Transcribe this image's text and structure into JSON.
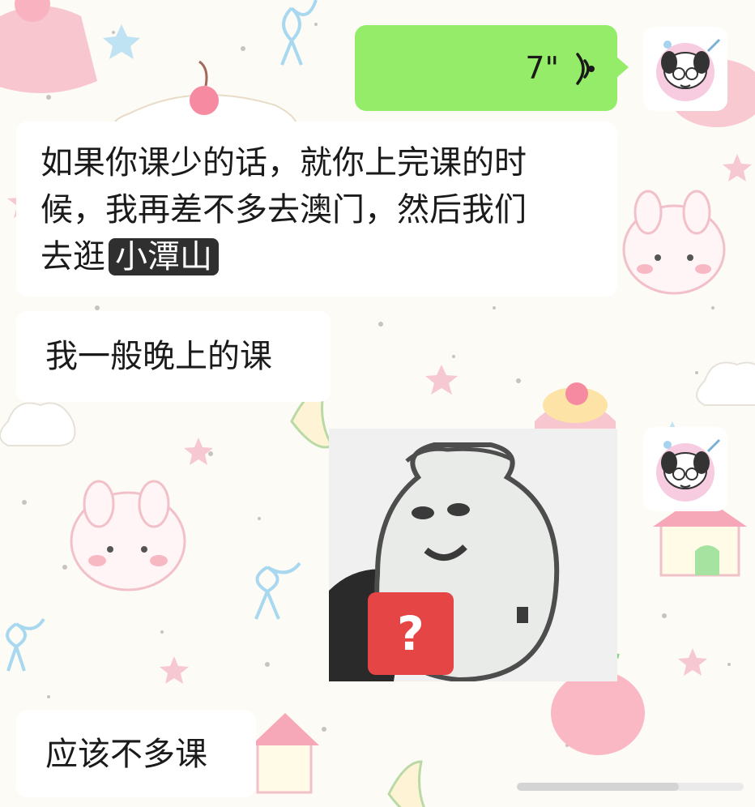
{
  "chat": {
    "voice_message": {
      "duration": "7\""
    },
    "messages": [
      {
        "text_line1": "如果你课少的话，就你上完课的时",
        "text_line2": "候，我再差不多去澳门，然后我们",
        "text_line3_prefix": "去逛",
        "highlight": "小潭山"
      },
      {
        "text": "我一般晚上的课"
      },
      {
        "text": "应该不多课"
      }
    ],
    "sticker": {
      "badge": "?"
    }
  },
  "colors": {
    "sent_bubble": "#95ec69",
    "received_bubble": "#ffffff",
    "highlight_bg": "#2f2f2f",
    "sticker_badge": "#e64545"
  },
  "icons": [
    "voice-wave-icon",
    "avatar-image",
    "question-badge-icon"
  ]
}
